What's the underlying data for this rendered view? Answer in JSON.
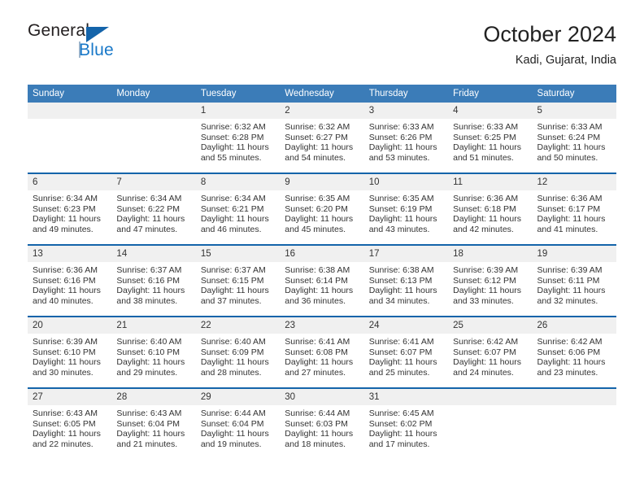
{
  "brand": {
    "name_part1": "General",
    "name_part2": "Blue",
    "triangle_color": "#1464aa",
    "blue_text_color": "#1878c8"
  },
  "header": {
    "title": "October 2024",
    "subtitle": "Kadi, Gujarat, India"
  },
  "theme": {
    "header_row_bg": "#3b7cb8",
    "row_separator": "#1464aa",
    "daynum_bg": "#f0f0f0",
    "text": "#333333"
  },
  "weekdays": [
    "Sunday",
    "Monday",
    "Tuesday",
    "Wednesday",
    "Thursday",
    "Friday",
    "Saturday"
  ],
  "labels": {
    "sunrise_prefix": "Sunrise:",
    "sunset_prefix": "Sunset:",
    "daylight_prefix": "Daylight:"
  },
  "weeks": [
    [
      {
        "day": "",
        "empty": true
      },
      {
        "day": "",
        "empty": true
      },
      {
        "day": "1",
        "sunrise": "Sunrise: 6:32 AM",
        "sunset": "Sunset: 6:28 PM",
        "daylight_line1": "Daylight: 11 hours",
        "daylight_line2": "and 55 minutes."
      },
      {
        "day": "2",
        "sunrise": "Sunrise: 6:32 AM",
        "sunset": "Sunset: 6:27 PM",
        "daylight_line1": "Daylight: 11 hours",
        "daylight_line2": "and 54 minutes."
      },
      {
        "day": "3",
        "sunrise": "Sunrise: 6:33 AM",
        "sunset": "Sunset: 6:26 PM",
        "daylight_line1": "Daylight: 11 hours",
        "daylight_line2": "and 53 minutes."
      },
      {
        "day": "4",
        "sunrise": "Sunrise: 6:33 AM",
        "sunset": "Sunset: 6:25 PM",
        "daylight_line1": "Daylight: 11 hours",
        "daylight_line2": "and 51 minutes."
      },
      {
        "day": "5",
        "sunrise": "Sunrise: 6:33 AM",
        "sunset": "Sunset: 6:24 PM",
        "daylight_line1": "Daylight: 11 hours",
        "daylight_line2": "and 50 minutes."
      }
    ],
    [
      {
        "day": "6",
        "sunrise": "Sunrise: 6:34 AM",
        "sunset": "Sunset: 6:23 PM",
        "daylight_line1": "Daylight: 11 hours",
        "daylight_line2": "and 49 minutes."
      },
      {
        "day": "7",
        "sunrise": "Sunrise: 6:34 AM",
        "sunset": "Sunset: 6:22 PM",
        "daylight_line1": "Daylight: 11 hours",
        "daylight_line2": "and 47 minutes."
      },
      {
        "day": "8",
        "sunrise": "Sunrise: 6:34 AM",
        "sunset": "Sunset: 6:21 PM",
        "daylight_line1": "Daylight: 11 hours",
        "daylight_line2": "and 46 minutes."
      },
      {
        "day": "9",
        "sunrise": "Sunrise: 6:35 AM",
        "sunset": "Sunset: 6:20 PM",
        "daylight_line1": "Daylight: 11 hours",
        "daylight_line2": "and 45 minutes."
      },
      {
        "day": "10",
        "sunrise": "Sunrise: 6:35 AM",
        "sunset": "Sunset: 6:19 PM",
        "daylight_line1": "Daylight: 11 hours",
        "daylight_line2": "and 43 minutes."
      },
      {
        "day": "11",
        "sunrise": "Sunrise: 6:36 AM",
        "sunset": "Sunset: 6:18 PM",
        "daylight_line1": "Daylight: 11 hours",
        "daylight_line2": "and 42 minutes."
      },
      {
        "day": "12",
        "sunrise": "Sunrise: 6:36 AM",
        "sunset": "Sunset: 6:17 PM",
        "daylight_line1": "Daylight: 11 hours",
        "daylight_line2": "and 41 minutes."
      }
    ],
    [
      {
        "day": "13",
        "sunrise": "Sunrise: 6:36 AM",
        "sunset": "Sunset: 6:16 PM",
        "daylight_line1": "Daylight: 11 hours",
        "daylight_line2": "and 40 minutes."
      },
      {
        "day": "14",
        "sunrise": "Sunrise: 6:37 AM",
        "sunset": "Sunset: 6:16 PM",
        "daylight_line1": "Daylight: 11 hours",
        "daylight_line2": "and 38 minutes."
      },
      {
        "day": "15",
        "sunrise": "Sunrise: 6:37 AM",
        "sunset": "Sunset: 6:15 PM",
        "daylight_line1": "Daylight: 11 hours",
        "daylight_line2": "and 37 minutes."
      },
      {
        "day": "16",
        "sunrise": "Sunrise: 6:38 AM",
        "sunset": "Sunset: 6:14 PM",
        "daylight_line1": "Daylight: 11 hours",
        "daylight_line2": "and 36 minutes."
      },
      {
        "day": "17",
        "sunrise": "Sunrise: 6:38 AM",
        "sunset": "Sunset: 6:13 PM",
        "daylight_line1": "Daylight: 11 hours",
        "daylight_line2": "and 34 minutes."
      },
      {
        "day": "18",
        "sunrise": "Sunrise: 6:39 AM",
        "sunset": "Sunset: 6:12 PM",
        "daylight_line1": "Daylight: 11 hours",
        "daylight_line2": "and 33 minutes."
      },
      {
        "day": "19",
        "sunrise": "Sunrise: 6:39 AM",
        "sunset": "Sunset: 6:11 PM",
        "daylight_line1": "Daylight: 11 hours",
        "daylight_line2": "and 32 minutes."
      }
    ],
    [
      {
        "day": "20",
        "sunrise": "Sunrise: 6:39 AM",
        "sunset": "Sunset: 6:10 PM",
        "daylight_line1": "Daylight: 11 hours",
        "daylight_line2": "and 30 minutes."
      },
      {
        "day": "21",
        "sunrise": "Sunrise: 6:40 AM",
        "sunset": "Sunset: 6:10 PM",
        "daylight_line1": "Daylight: 11 hours",
        "daylight_line2": "and 29 minutes."
      },
      {
        "day": "22",
        "sunrise": "Sunrise: 6:40 AM",
        "sunset": "Sunset: 6:09 PM",
        "daylight_line1": "Daylight: 11 hours",
        "daylight_line2": "and 28 minutes."
      },
      {
        "day": "23",
        "sunrise": "Sunrise: 6:41 AM",
        "sunset": "Sunset: 6:08 PM",
        "daylight_line1": "Daylight: 11 hours",
        "daylight_line2": "and 27 minutes."
      },
      {
        "day": "24",
        "sunrise": "Sunrise: 6:41 AM",
        "sunset": "Sunset: 6:07 PM",
        "daylight_line1": "Daylight: 11 hours",
        "daylight_line2": "and 25 minutes."
      },
      {
        "day": "25",
        "sunrise": "Sunrise: 6:42 AM",
        "sunset": "Sunset: 6:07 PM",
        "daylight_line1": "Daylight: 11 hours",
        "daylight_line2": "and 24 minutes."
      },
      {
        "day": "26",
        "sunrise": "Sunrise: 6:42 AM",
        "sunset": "Sunset: 6:06 PM",
        "daylight_line1": "Daylight: 11 hours",
        "daylight_line2": "and 23 minutes."
      }
    ],
    [
      {
        "day": "27",
        "sunrise": "Sunrise: 6:43 AM",
        "sunset": "Sunset: 6:05 PM",
        "daylight_line1": "Daylight: 11 hours",
        "daylight_line2": "and 22 minutes."
      },
      {
        "day": "28",
        "sunrise": "Sunrise: 6:43 AM",
        "sunset": "Sunset: 6:04 PM",
        "daylight_line1": "Daylight: 11 hours",
        "daylight_line2": "and 21 minutes."
      },
      {
        "day": "29",
        "sunrise": "Sunrise: 6:44 AM",
        "sunset": "Sunset: 6:04 PM",
        "daylight_line1": "Daylight: 11 hours",
        "daylight_line2": "and 19 minutes."
      },
      {
        "day": "30",
        "sunrise": "Sunrise: 6:44 AM",
        "sunset": "Sunset: 6:03 PM",
        "daylight_line1": "Daylight: 11 hours",
        "daylight_line2": "and 18 minutes."
      },
      {
        "day": "31",
        "sunrise": "Sunrise: 6:45 AM",
        "sunset": "Sunset: 6:02 PM",
        "daylight_line1": "Daylight: 11 hours",
        "daylight_line2": "and 17 minutes."
      },
      {
        "day": "",
        "empty": true
      },
      {
        "day": "",
        "empty": true
      }
    ]
  ]
}
